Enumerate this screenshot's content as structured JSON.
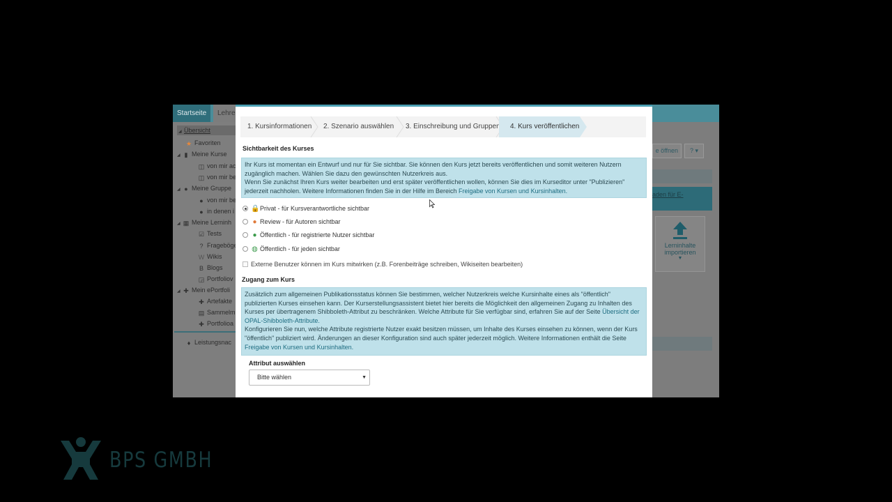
{
  "background_app": {
    "tabs": [
      "Startseite",
      "Lehrer"
    ],
    "sidebar": [
      {
        "label": "Übersicht",
        "icon": "none",
        "level": 0
      },
      {
        "label": "Favoriten",
        "icon": "star-icon",
        "level": 1
      },
      {
        "label": "Meine Kurse",
        "icon": "book-icon",
        "level": 0
      },
      {
        "label": "von mir ac",
        "icon": "open-book-icon",
        "level": 2
      },
      {
        "label": "von mir be",
        "icon": "open-book-icon",
        "level": 2
      },
      {
        "label": "Meine Gruppe",
        "icon": "group-icon",
        "level": 0
      },
      {
        "label": "von mir be",
        "icon": "user-icon",
        "level": 2
      },
      {
        "label": "in denen i",
        "icon": "user-icon",
        "level": 2
      },
      {
        "label": "Meine Lerninh",
        "icon": "grid-icon",
        "level": 0
      },
      {
        "label": "Tests",
        "icon": "check-icon",
        "level": 2
      },
      {
        "label": "Frageböge",
        "icon": "question-icon",
        "level": 2
      },
      {
        "label": "Wikis",
        "icon": "wiki-icon",
        "level": 2
      },
      {
        "label": "Blogs",
        "icon": "blog-icon",
        "level": 2
      },
      {
        "label": "Portfoliov",
        "icon": "portfolio-icon",
        "level": 2
      },
      {
        "label": "Mein ePortfoli",
        "icon": "puzzle-icon",
        "level": 0
      },
      {
        "label": "Artefakte",
        "icon": "puzzle-piece-icon",
        "level": 2
      },
      {
        "label": "Sammelm",
        "icon": "folder-icon",
        "level": 2
      },
      {
        "label": "Portfolioa",
        "icon": "puzzle-piece-icon",
        "level": 2
      },
      {
        "label": "Leistungsnac",
        "icon": "trophy-icon",
        "level": 1
      }
    ],
    "right_panel": {
      "open_button": "e öffnen",
      "help_button": "?",
      "teal_link": "aden für E-",
      "import_label": "Lerninhalte importieren"
    }
  },
  "wizard": {
    "steps": [
      "1. Kursinformationen",
      "2. Szenario auswählen",
      "3. Einschreibung und Gruppen",
      "4. Kurs veröffentlichen"
    ],
    "active_step": 4
  },
  "visibility": {
    "heading": "Sichtbarkeit des Kurses",
    "info_line1": "Ihr Kurs ist momentan ein Entwurf und nur für Sie sichtbar. Sie können den Kurs jetzt bereits veröffentlichen und somit weiteren Nutzern zugänglich machen. Wählen Sie dazu den gewünschten Nutzerkreis aus.",
    "info_line2": "Wenn Sie zunächst Ihren Kurs weiter bearbeiten und erst später veröffentlichen wollen, können Sie dies im Kurseditor unter \"Publizieren\" jederzeit nachholen. Weitere Informationen finden Sie in der Hilfe im Bereich ",
    "info_link": "Freigabe von Kursen und Kursinhalten.",
    "options": [
      {
        "label": "Privat - für Kursverantwortliche sichtbar",
        "icon": "lock-icon",
        "selected": true
      },
      {
        "label": "Review - für Autoren sichtbar",
        "icon": "review-user-icon",
        "selected": false
      },
      {
        "label": "Öffentlich - für registrierte Nutzer sichtbar",
        "icon": "registered-user-icon",
        "selected": false
      },
      {
        "label": "Öffentlich - für jeden sichtbar",
        "icon": "globe-icon",
        "selected": false
      }
    ],
    "external_checkbox": "Externe Benutzer können im Kurs mitwirken (z.B. Forenbeiträge schreiben, Wikiseiten bearbeiten)"
  },
  "access": {
    "heading": "Zugang zum Kurs",
    "info_text1": "Zusätzlich zum allgemeinen Publikationsstatus können Sie bestimmen, welcher Nutzerkreis welche Kursinhalte eines als \"öffentlich\" publizierten Kurses einsehen kann. Der Kurserstellungsassistent bietet hier bereits die Möglichkeit den allgemeinen Zugang zu Inhalten des Kurses per übertragenem Shibboleth-Attribut zu beschränken. Welche Attribute für Sie verfügbar sind, erfahren Sie auf der Seite ",
    "info_link1": "Übersicht der OPAL-Shibboleth-Attribute.",
    "info_text2": "Konfigurieren Sie nun, welche Attribute registrierte Nutzer exakt besitzen müssen, um Inhalte des Kurses einsehen zu können, wenn der Kurs \"öffentlich\" publiziert wird. Änderungen an dieser Konfiguration sind auch später jederzeit möglich. Weitere Informationen enthält die Seite ",
    "info_link2": "Freigabe von Kursen und Kursinhalten.",
    "attribute_label": "Attribut auswählen",
    "select_value": "Bitte wählen"
  },
  "watermark": {
    "text": "BPS GMBH"
  }
}
